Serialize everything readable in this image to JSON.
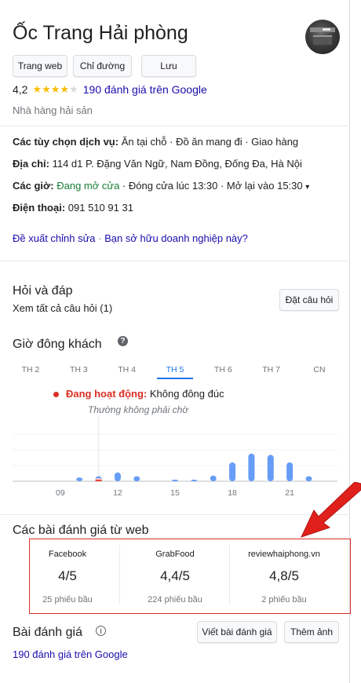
{
  "place": {
    "name": "Ốc Trang Hải phòng",
    "category": "Nhà hàng hải sản",
    "rating": "4,2",
    "stars_filled": 4,
    "stars_total": 5,
    "review_count_text": "190 đánh giá trên Google"
  },
  "actions": {
    "website": "Trang web",
    "directions": "Chỉ đường",
    "save": "Lưu"
  },
  "details": {
    "services_label": "Các tùy chọn dịch vụ:",
    "services_value": "Ăn tại chỗ · Đồ ăn mang đi · Giao hàng",
    "address_label": "Địa chỉ:",
    "address_value": "114 d1 P. Đặng Văn Ngữ, Nam Đồng, Đống Đa, Hà Nội",
    "hours_label": "Các giờ:",
    "hours_status": "Đang mở cửa",
    "hours_rest": "· Đóng cửa lúc 13:30 · Mở lại vào 15:30",
    "hours_caret": "▾",
    "phone_label": "Điện thoại:",
    "phone_value": "091 510 91 31",
    "suggest_edit": "Đề xuất chỉnh sửa",
    "separator": "·",
    "own_business": "Bạn sở hữu doanh nghiệp này?"
  },
  "qa": {
    "title": "Hỏi và đáp",
    "see_all": "Xem tất cả câu hỏi (1)",
    "ask_button": "Đặt câu hỏi"
  },
  "popular_times": {
    "title": "Giờ đông khách",
    "help_icon": "help-circle-icon",
    "days": [
      "TH 2",
      "TH 3",
      "TH 4",
      "TH 5",
      "TH 6",
      "TH 7",
      "CN"
    ],
    "active_day_index": 3,
    "live_label": "Đang hoạt động:",
    "live_value": "Không đông đúc",
    "live_sub": "Thường không phải chờ"
  },
  "chart_data": {
    "type": "bar",
    "x": [
      7,
      8,
      9,
      10,
      11,
      12,
      13,
      14,
      15,
      16,
      17,
      18,
      19,
      20,
      21,
      22
    ],
    "values": [
      0,
      0,
      0,
      6,
      8,
      14,
      8,
      0,
      1,
      2,
      9,
      30,
      44,
      42,
      30,
      8
    ],
    "live_x": 11,
    "live_value": 5,
    "tick_labels": [
      "09",
      "12",
      "15",
      "18",
      "21"
    ],
    "tick_values": [
      9,
      12,
      15,
      18,
      21
    ],
    "ylim": [
      0,
      100
    ],
    "xlim": [
      6.5,
      23.5
    ],
    "bar_color": "#669df6",
    "live_color": "#ea4335",
    "grid": true
  },
  "web_reviews": {
    "title": "Các bài đánh giá từ web",
    "items": [
      {
        "source": "Facebook",
        "score": "4/5",
        "votes": "25 phiếu bầu"
      },
      {
        "source": "GrabFood",
        "score": "4,4/5",
        "votes": "224 phiếu bầu"
      },
      {
        "source": "reviewhaiphong.vn",
        "score": "4,8/5",
        "votes": "2 phiếu bầu"
      }
    ],
    "highlight_color": "#d93025"
  },
  "reviews": {
    "title": "Bài đánh giá",
    "info_icon": "info-icon",
    "write_button": "Viết bài đánh giá",
    "add_photo_button": "Thêm ảnh",
    "count_link": "190 đánh giá trên Google"
  },
  "colors": {
    "link": "#1a0dab",
    "open": "#188038",
    "star": "#fbbc04",
    "accent": "#1a73e8"
  }
}
